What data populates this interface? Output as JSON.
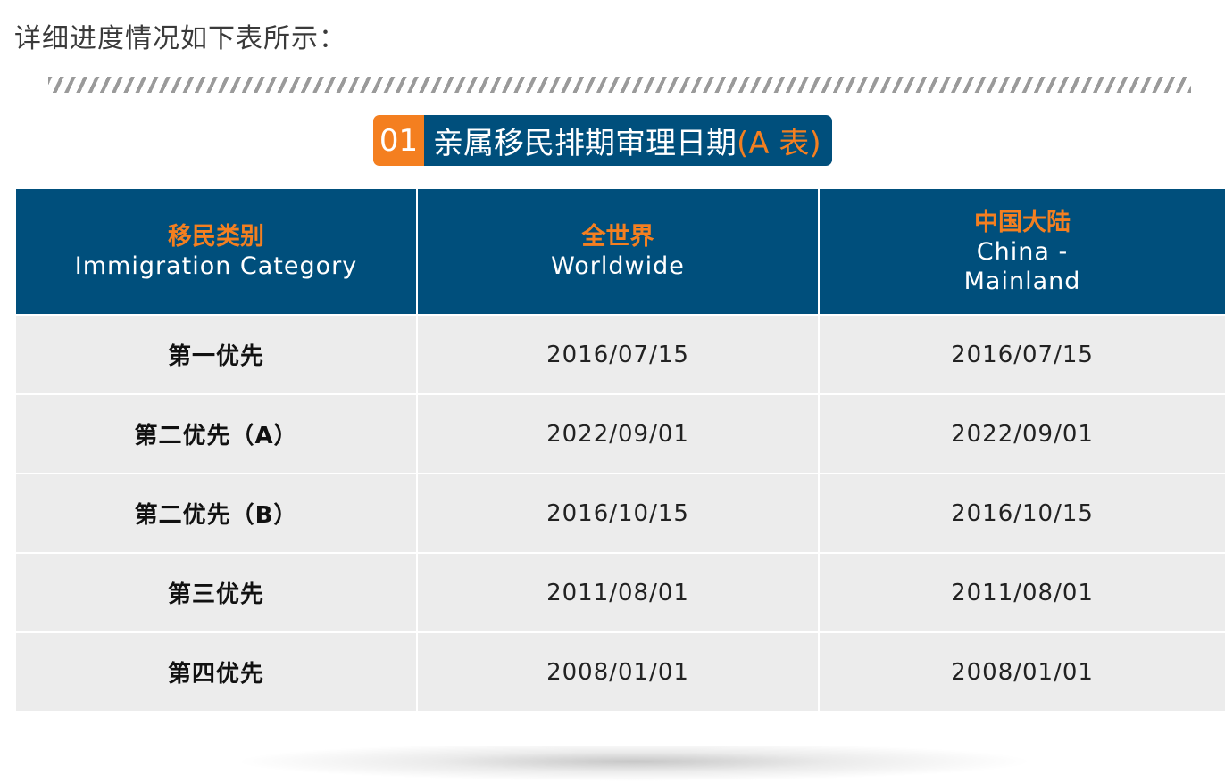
{
  "intro_text": "详细进度情况如下表所示：",
  "section": {
    "number": "01",
    "title": "亲属移民排期审理日期",
    "suffix": "(A 表)"
  },
  "table": {
    "headers": [
      {
        "zh": "移民类别",
        "en": "Immigration Category"
      },
      {
        "zh": "全世界",
        "en": "Worldwide"
      },
      {
        "zh": "中国大陆",
        "en": "China -\nMainland"
      }
    ],
    "rows": [
      {
        "category": "第一优先",
        "worldwide": "2016/07/15",
        "china": "2016/07/15"
      },
      {
        "category": "第二优先（A）",
        "worldwide": "2022/09/01",
        "china": "2022/09/01"
      },
      {
        "category": "第二优先（B）",
        "worldwide": "2016/10/15",
        "china": "2016/10/15"
      },
      {
        "category": "第三优先",
        "worldwide": "2011/08/01",
        "china": "2011/08/01"
      },
      {
        "category": "第四优先",
        "worldwide": "2008/01/01",
        "china": "2008/01/01"
      }
    ]
  },
  "colors": {
    "header_bg": "#004f7c",
    "accent": "#f47f20",
    "row_bg": "#ececec"
  }
}
